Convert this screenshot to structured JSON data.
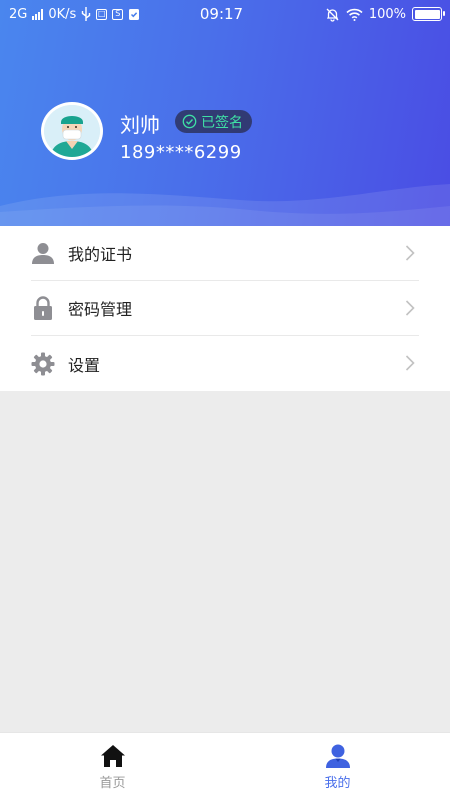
{
  "status_bar": {
    "network": "2G",
    "speed": "0K/s",
    "time": "09:17",
    "battery": "100%",
    "battery_level": 1.0
  },
  "profile": {
    "name": "刘帅",
    "badge": "已签名",
    "phone": "189****6299"
  },
  "menu": {
    "items": [
      {
        "label": "我的证书",
        "icon": "person-icon"
      },
      {
        "label": "密码管理",
        "icon": "lock-icon"
      },
      {
        "label": "设置",
        "icon": "gear-icon"
      }
    ]
  },
  "tabbar": {
    "tabs": [
      {
        "label": "首页",
        "icon": "home-icon",
        "active": false
      },
      {
        "label": "我的",
        "icon": "user-icon",
        "active": true
      }
    ]
  },
  "colors": {
    "header_start": "#4a86ee",
    "header_end": "#4a4de4",
    "badge_text": "#3fe0a5",
    "tab_active": "#4a6fea",
    "tab_inactive": "#999999",
    "menu_icon": "#8e8e93",
    "page_background": "#ececec"
  }
}
